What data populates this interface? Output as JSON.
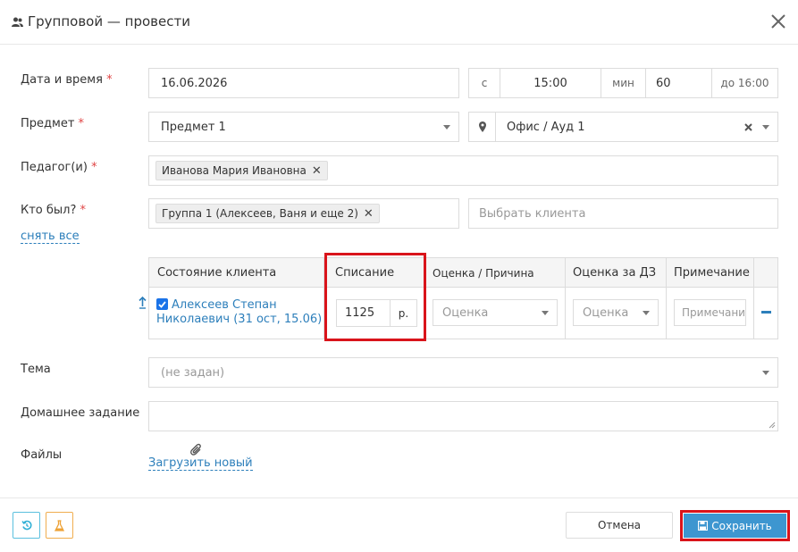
{
  "header": {
    "title": "Групповой — провести"
  },
  "labels": {
    "date_time": "Дата и время",
    "subject": "Предмет",
    "teachers": "Педагог(и)",
    "who_was": "Кто был?",
    "topic": "Тема",
    "homework": "Домашнее задание",
    "files": "Файлы",
    "required_mark": "*"
  },
  "datetime": {
    "date": "16.06.2026",
    "from_label": "с",
    "time": "15:00",
    "min_label": "мин",
    "minutes": "60",
    "until": "до 16:00"
  },
  "subject": {
    "value": "Предмет 1"
  },
  "location": {
    "value": "Офис / Ауд 1"
  },
  "teachers": {
    "tag": "Иванова Мария Ивановна"
  },
  "attendance": {
    "group_tag": "Группа 1 (Алексеев, Ваня и еще 2)",
    "client_placeholder": "Выбрать клиента",
    "clear_all": "снять все"
  },
  "table": {
    "headers": {
      "state": "Состояние клиента",
      "charge": "Списание",
      "grade": "Оценка / Причина",
      "hw_grade": "Оценка за ДЗ",
      "note": "Примечание"
    },
    "row": {
      "client_line1": "Алексеев Степан",
      "client_line2": "Николаевич (31 ост, 15.06)",
      "checked": true,
      "charge_value": "1125",
      "currency": "р.",
      "grade_placeholder": "Оценка",
      "hw_grade_placeholder": "Оценка",
      "note_placeholder": "Примечание"
    }
  },
  "topic": {
    "placeholder": "(не задан)"
  },
  "files": {
    "upload": "Загрузить новый"
  },
  "footer": {
    "cancel": "Отмена",
    "save": "Сохранить"
  },
  "colors": {
    "accent": "#3d96d0",
    "highlight": "#d9141b",
    "link": "#2d7fbb"
  }
}
